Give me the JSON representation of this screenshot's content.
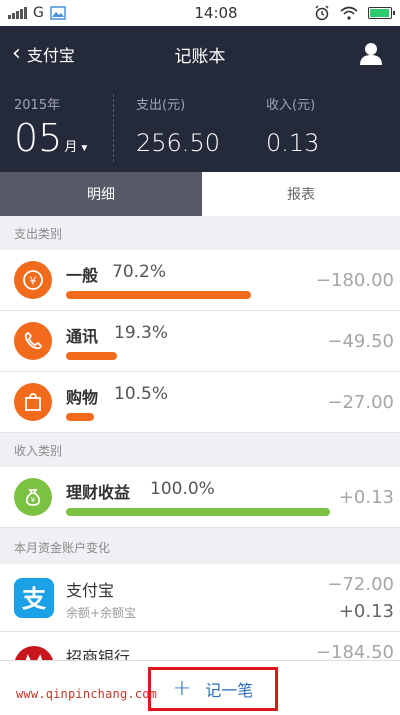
{
  "status_bar": {
    "network": "G",
    "time": "14:08"
  },
  "nav": {
    "back_label": "支付宝",
    "title": "记账本"
  },
  "summary": {
    "year": "2015年",
    "month_number": "05",
    "month_suffix": "月",
    "expense_label": "支出(元)",
    "expense_value": "256.50",
    "income_label": "收入(元)",
    "income_value": "0.13"
  },
  "tabs": [
    {
      "label": "明细"
    },
    {
      "label": "报表"
    }
  ],
  "expense_section": {
    "title": "支出类别",
    "items": [
      {
        "name": "一般",
        "percent": "70.2%",
        "amount": "−180.00",
        "share": 0.702,
        "icon": "yen-icon",
        "color": "#f26b1d"
      },
      {
        "name": "通讯",
        "percent": "19.3%",
        "amount": "−49.50",
        "share": 0.193,
        "icon": "phone-icon",
        "color": "#f26b1d"
      },
      {
        "name": "购物",
        "percent": "10.5%",
        "amount": "−27.00",
        "share": 0.105,
        "icon": "shopping-bag-icon",
        "color": "#f26b1d"
      }
    ]
  },
  "income_section": {
    "title": "收入类别",
    "items": [
      {
        "name": "理财收益",
        "percent": "100.0%",
        "amount": "+0.13",
        "share": 1.0,
        "icon": "money-bag-icon",
        "color": "#7cc242"
      }
    ]
  },
  "account_section": {
    "title": "本月资金账户变化",
    "items": [
      {
        "name": "支付宝",
        "sub": "余额+余额宝",
        "amount_out": "−72.00",
        "amount_in": "+0.13",
        "logo": "alipay-logo-icon"
      },
      {
        "name": "招商银行",
        "amount_out": "−184.50",
        "logo": "cmb-logo-icon"
      }
    ]
  },
  "bottom": {
    "watermark": "www.qinpinchang.com",
    "add_label": "记一笔"
  },
  "colors": {
    "header_bg": "#252a3a",
    "expense": "#f26b1d",
    "income": "#7cc242",
    "alipay": "#1aa1e6",
    "cmb": "#c8161d"
  }
}
